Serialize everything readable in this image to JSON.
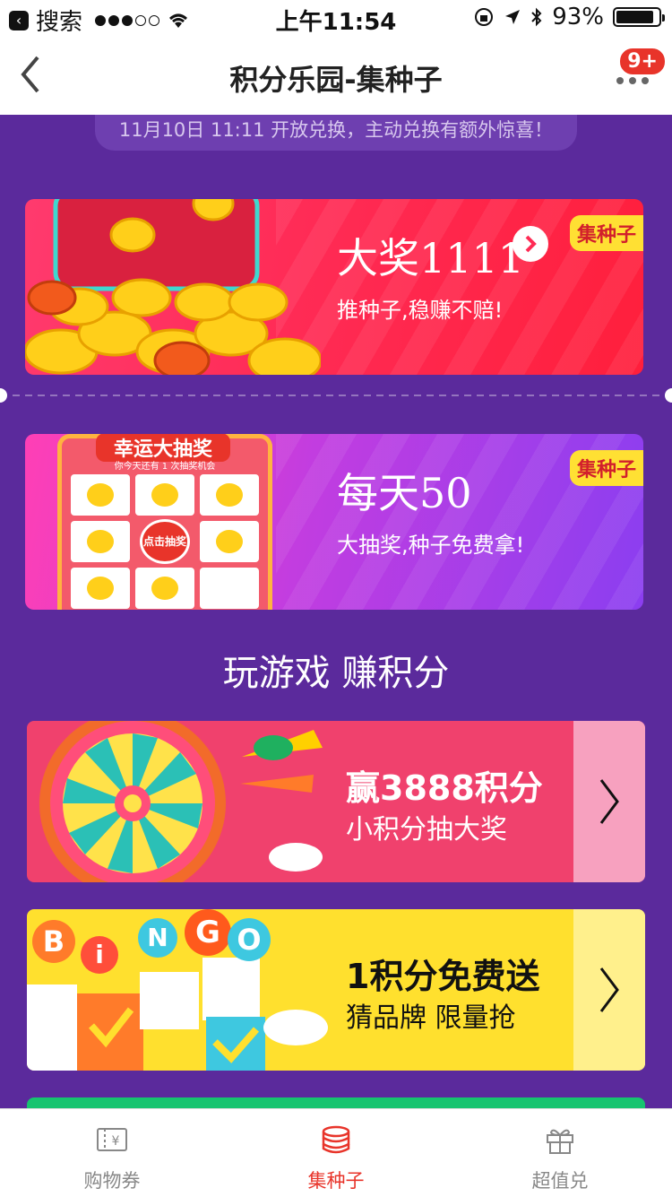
{
  "status_bar": {
    "back_app": "搜索",
    "time": "上午11:54",
    "battery": "93%",
    "battery_level": 0.93
  },
  "nav": {
    "title": "积分乐园-集种子",
    "badge": "9+"
  },
  "notice": "11月10日 11:11 开放兑换，主动兑换有额外惊喜！",
  "banners": [
    {
      "tag": "集种子",
      "title": "大奖1111",
      "subtitle": "推种子,稳赚不赔!"
    },
    {
      "tag": "集种子",
      "title": "每天50",
      "subtitle": "大抽奖,种子免费拿!",
      "art_title": "幸运大抽奖",
      "art_sub": "你今天还有 1 次抽奖机会",
      "art_button": "点击抽奖"
    }
  ],
  "section_title": "玩游戏 赚积分",
  "games": [
    {
      "title": "赢3888积分",
      "subtitle": "小积分抽大奖"
    },
    {
      "title": "1积分免费送",
      "subtitle": "猜品牌  限量抢",
      "art_letters": [
        "B",
        "i",
        "N",
        "G",
        "O"
      ]
    }
  ],
  "tabs": [
    {
      "label": "购物券",
      "icon": "coupon-icon"
    },
    {
      "label": "集种子",
      "icon": "coin-stack-icon",
      "active": true
    },
    {
      "label": "超值兑",
      "icon": "gift-icon"
    }
  ],
  "colors": {
    "page_bg": "#5b2a9c",
    "accent": "#e8342a",
    "tag_bg": "#ffe033"
  }
}
